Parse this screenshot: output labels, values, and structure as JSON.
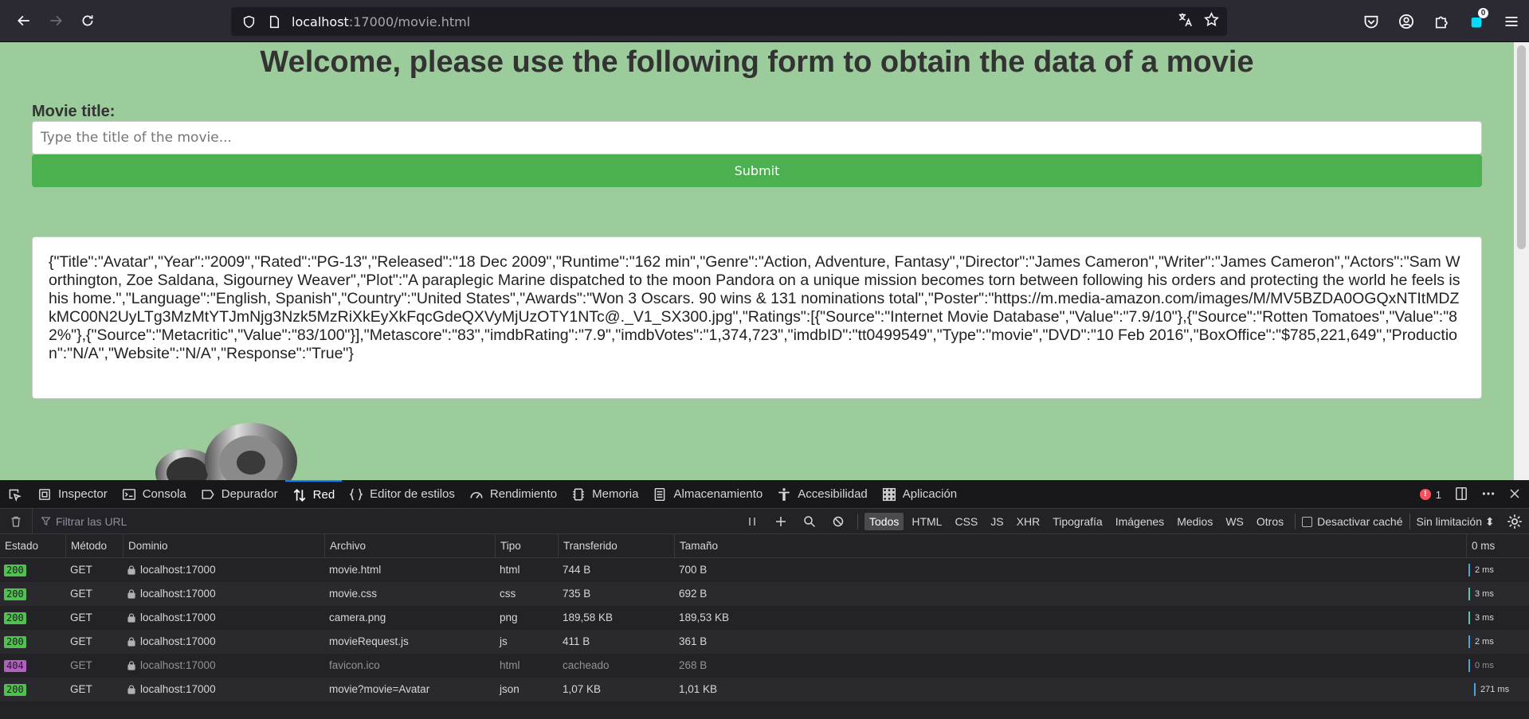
{
  "browser": {
    "url_host": "localhost",
    "url_rest": ":17000/movie.html",
    "extension_badge": "0"
  },
  "page": {
    "heading": "Welcome, please use the following form to obtain the data of a movie",
    "movie_title_label": "Movie title:",
    "title_placeholder": "Type the title of the movie...",
    "submit_label": "Submit",
    "result_json": "{\"Title\":\"Avatar\",\"Year\":\"2009\",\"Rated\":\"PG-13\",\"Released\":\"18 Dec 2009\",\"Runtime\":\"162 min\",\"Genre\":\"Action, Adventure, Fantasy\",\"Director\":\"James Cameron\",\"Writer\":\"James Cameron\",\"Actors\":\"Sam Worthington, Zoe Saldana, Sigourney Weaver\",\"Plot\":\"A paraplegic Marine dispatched to the moon Pandora on a unique mission becomes torn between following his orders and protecting the world he feels is his home.\",\"Language\":\"English, Spanish\",\"Country\":\"United States\",\"Awards\":\"Won 3 Oscars. 90 wins & 131 nominations total\",\"Poster\":\"https://m.media-amazon.com/images/M/MV5BZDA0OGQxNTItMDZkMC00N2UyLTg3MzMtYTJmNjg3Nzk5MzRiXkEyXkFqcGdeQXVyMjUzOTY1NTc@._V1_SX300.jpg\",\"Ratings\":[{\"Source\":\"Internet Movie Database\",\"Value\":\"7.9/10\"},{\"Source\":\"Rotten Tomatoes\",\"Value\":\"82%\"},{\"Source\":\"Metacritic\",\"Value\":\"83/100\"}],\"Metascore\":\"83\",\"imdbRating\":\"7.9\",\"imdbVotes\":\"1,374,723\",\"imdbID\":\"tt0499549\",\"Type\":\"movie\",\"DVD\":\"10 Feb 2016\",\"BoxOffice\":\"$785,221,649\",\"Production\":\"N/A\",\"Website\":\"N/A\",\"Response\":\"True\"}"
  },
  "devtools": {
    "tabs": [
      {
        "label": "Inspector",
        "icon": "inspector-icon"
      },
      {
        "label": "Consola",
        "icon": "console-icon"
      },
      {
        "label": "Depurador",
        "icon": "debugger-icon"
      },
      {
        "label": "Red",
        "icon": "network-icon"
      },
      {
        "label": "Editor de estilos",
        "icon": "style-editor-icon"
      },
      {
        "label": "Rendimiento",
        "icon": "performance-icon"
      },
      {
        "label": "Memoria",
        "icon": "memory-icon"
      },
      {
        "label": "Almacenamiento",
        "icon": "storage-icon"
      },
      {
        "label": "Accesibilidad",
        "icon": "accessibility-icon"
      },
      {
        "label": "Aplicación",
        "icon": "application-icon"
      }
    ],
    "error_count": "1",
    "filter_placeholder": "Filtrar las URL",
    "type_filters": [
      "Todos",
      "HTML",
      "CSS",
      "JS",
      "XHR",
      "Tipografía",
      "Imágenes",
      "Medios",
      "WS",
      "Otros"
    ],
    "disable_cache_label": "Desactivar caché",
    "throttling_label": "Sin limitación ⬍",
    "columns": {
      "status": "Estado",
      "method": "Método",
      "domain": "Dominio",
      "file": "Archivo",
      "type": "Tipo",
      "transferred": "Transferido",
      "size": "Tamaño",
      "waterfall": "0 ms"
    },
    "requests": [
      {
        "status": "200",
        "method": "GET",
        "domain": "localhost:17000",
        "file": "movie.html",
        "type": "html",
        "transferred": "744 B",
        "size": "700 B",
        "time": "2 ms"
      },
      {
        "status": "200",
        "method": "GET",
        "domain": "localhost:17000",
        "file": "movie.css",
        "type": "css",
        "transferred": "735 B",
        "size": "692 B",
        "time": "3 ms"
      },
      {
        "status": "200",
        "method": "GET",
        "domain": "localhost:17000",
        "file": "camera.png",
        "type": "png",
        "transferred": "189,58 KB",
        "size": "189,53 KB",
        "time": "3 ms"
      },
      {
        "status": "200",
        "method": "GET",
        "domain": "localhost:17000",
        "file": "movieRequest.js",
        "type": "js",
        "transferred": "411 B",
        "size": "361 B",
        "time": "2 ms"
      },
      {
        "status": "404",
        "method": "GET",
        "domain": "localhost:17000",
        "file": "favicon.ico",
        "type": "html",
        "transferred": "cacheado",
        "size": "268 B",
        "time": "0 ms"
      },
      {
        "status": "200",
        "method": "GET",
        "domain": "localhost:17000",
        "file": "movie?movie=Avatar",
        "type": "json",
        "transferred": "1,07 KB",
        "size": "1,01 KB",
        "time": "271 ms"
      }
    ]
  }
}
